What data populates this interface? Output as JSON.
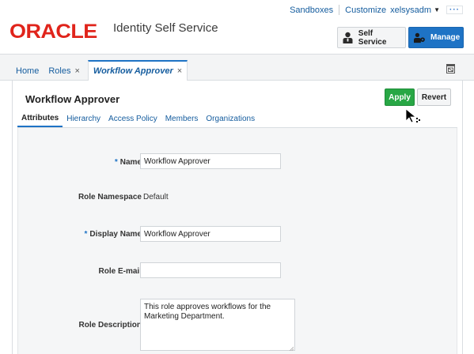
{
  "header": {
    "top_links": {
      "sandboxes": "Sandboxes",
      "customize": "Customize",
      "user": "xelsysadm"
    },
    "brand": "ORACLE",
    "app_title": "Identity Self Service",
    "self_service_label": "Self Service",
    "manage_label": "Manage"
  },
  "tabs": [
    {
      "label": "Home"
    },
    {
      "label": "Roles",
      "closable": true
    },
    {
      "label": "Workflow Approver",
      "closable": true,
      "active": true
    }
  ],
  "page": {
    "title": "Workflow Approver",
    "apply_label": "Apply",
    "revert_label": "Revert",
    "subtabs": [
      "Attributes",
      "Hierarchy",
      "Access Policy",
      "Members",
      "Organizations"
    ],
    "active_subtab": "Attributes"
  },
  "form": {
    "name": {
      "label": "Name",
      "required": true,
      "value": "Workflow Approver"
    },
    "role_namespace": {
      "label": "Role Namespace",
      "value": "Default"
    },
    "display_name": {
      "label": "Display Name",
      "required": true,
      "value": "Workflow Approver"
    },
    "role_email": {
      "label": "Role E-mail",
      "value": ""
    },
    "role_description": {
      "label": "Role Description",
      "value": "This role approves workflows for the Marketing Department."
    }
  },
  "colors": {
    "brand_red": "#e0241b",
    "accent_blue": "#1e73c5",
    "apply_green": "#28a745"
  },
  "icons": [
    "chevron-down-icon",
    "more-icon",
    "self-service-user-icon",
    "manage-users-icon",
    "close-icon",
    "restore-window-icon",
    "resize-grip-icon",
    "mouse-cursor-icon"
  ]
}
